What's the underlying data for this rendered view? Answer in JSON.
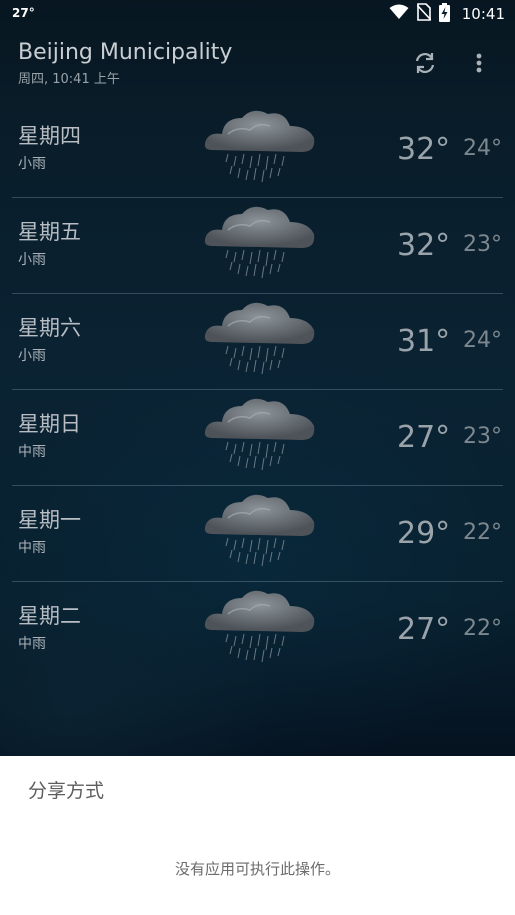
{
  "status_bar": {
    "temperature": "27°",
    "time": "10:41",
    "icons": [
      "wifi-icon",
      "no-sim-icon",
      "battery-charging-icon"
    ]
  },
  "app_bar": {
    "city": "Beijing Municipality",
    "updated": "周四, 10:41 上午",
    "icons": [
      "refresh-icon",
      "more-vert-icon"
    ]
  },
  "forecast": [
    {
      "day": "星期四",
      "condition": "小雨",
      "high": "32°",
      "low": "24°",
      "icon": "light-rain-cloud-icon"
    },
    {
      "day": "星期五",
      "condition": "小雨",
      "high": "32°",
      "low": "23°",
      "icon": "light-rain-cloud-icon"
    },
    {
      "day": "星期六",
      "condition": "小雨",
      "high": "31°",
      "low": "24°",
      "icon": "light-rain-cloud-icon"
    },
    {
      "day": "星期日",
      "condition": "中雨",
      "high": "27°",
      "low": "23°",
      "icon": "moderate-rain-cloud-icon"
    },
    {
      "day": "星期一",
      "condition": "中雨",
      "high": "29°",
      "low": "22°",
      "icon": "moderate-rain-cloud-icon"
    },
    {
      "day": "星期二",
      "condition": "中雨",
      "high": "27°",
      "low": "22°",
      "icon": "moderate-rain-cloud-icon"
    }
  ],
  "share_sheet": {
    "title": "分享方式",
    "empty_message": "没有应用可执行此操作。"
  },
  "colors": {
    "background": "#0d2d42",
    "sheet": "#ffffff",
    "text_primary": "#b8bec3",
    "text_secondary": "#7d878e"
  }
}
